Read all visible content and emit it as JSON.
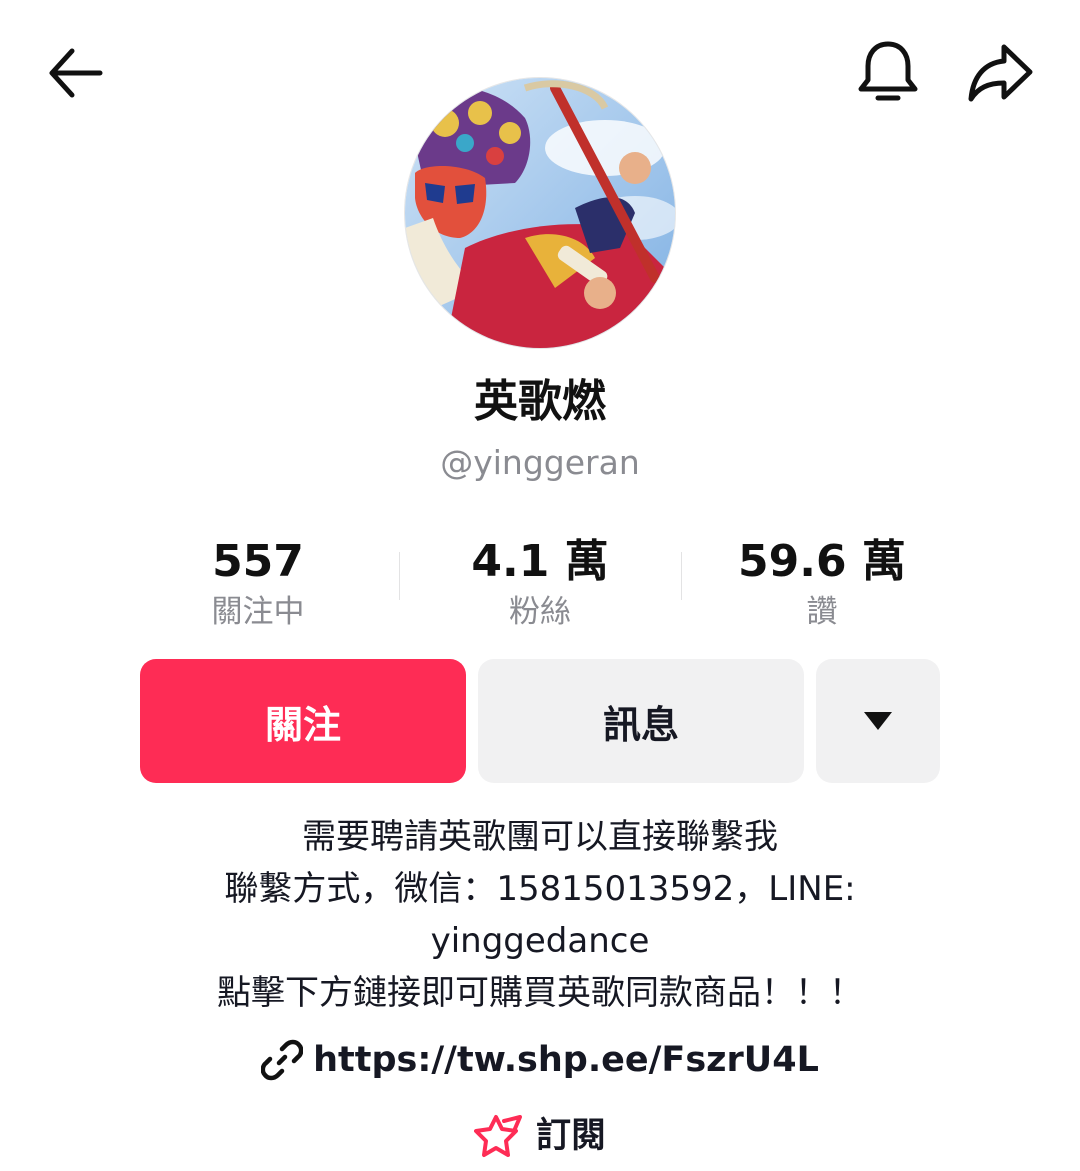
{
  "header": {
    "back_icon": "arrow-left-icon",
    "bell_icon": "bell-icon",
    "share_icon": "share-arrow-icon"
  },
  "profile": {
    "display_name": "英歌燃",
    "username": "@yinggeran"
  },
  "stats": [
    {
      "value": "557",
      "label": "關注中"
    },
    {
      "value": "4.1 萬",
      "label": "粉絲"
    },
    {
      "value": "59.6 萬",
      "label": "讚"
    }
  ],
  "actions": {
    "follow_label": "關注",
    "message_label": "訊息",
    "more_icon": "caret-down-icon"
  },
  "bio": {
    "lines": [
      "需要聘請英歌團可以直接聯繫我",
      "聯繫方式，微信：15815013592，LINE:",
      "yinggedance",
      "點擊下方鏈接即可購買英歌同款商品！！！"
    ]
  },
  "link": {
    "icon": "link-icon",
    "url": "https://tw.shp.ee/FszrU4L"
  },
  "subscription": {
    "icon": "subscribe-star-icon",
    "label": "訂閱"
  },
  "colors": {
    "accent": "#fe2c55",
    "secondary_button": "#f1f1f2",
    "muted_text": "#8a8b91",
    "primary_text": "#161823"
  }
}
